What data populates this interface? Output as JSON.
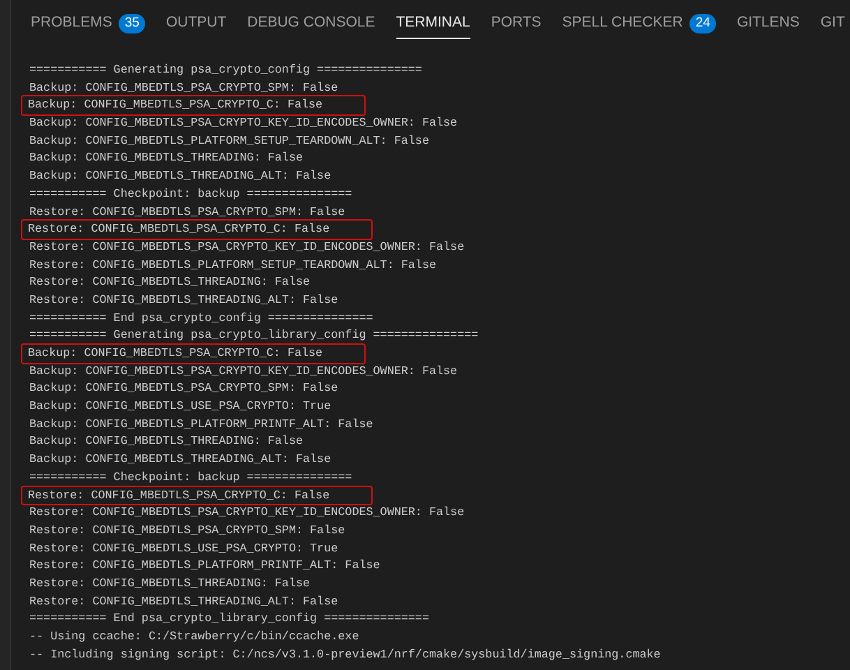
{
  "tabs": [
    {
      "label": "PROBLEMS",
      "badge": "35",
      "selected": false
    },
    {
      "label": "OUTPUT",
      "selected": false
    },
    {
      "label": "DEBUG CONSOLE",
      "selected": false
    },
    {
      "label": "TERMINAL",
      "selected": true
    },
    {
      "label": "PORTS",
      "selected": false
    },
    {
      "label": "SPELL CHECKER",
      "badge": "24",
      "selected": false
    },
    {
      "label": "GITLENS",
      "selected": false
    },
    {
      "label": "GIT",
      "selected": false
    }
  ],
  "terminal": {
    "lines": [
      {
        "text": "=========== Generating psa_crypto_config ===============",
        "highlighted": false
      },
      {
        "text": "Backup: CONFIG_MBEDTLS_PSA_CRYPTO_SPM: False",
        "highlighted": false
      },
      {
        "text": "Backup: CONFIG_MBEDTLS_PSA_CRYPTO_C: False",
        "highlighted": true
      },
      {
        "text": "Backup: CONFIG_MBEDTLS_PSA_CRYPTO_KEY_ID_ENCODES_OWNER: False",
        "highlighted": false
      },
      {
        "text": "Backup: CONFIG_MBEDTLS_PLATFORM_SETUP_TEARDOWN_ALT: False",
        "highlighted": false
      },
      {
        "text": "Backup: CONFIG_MBEDTLS_THREADING: False",
        "highlighted": false
      },
      {
        "text": "Backup: CONFIG_MBEDTLS_THREADING_ALT: False",
        "highlighted": false
      },
      {
        "text": "=========== Checkpoint: backup ===============",
        "highlighted": false
      },
      {
        "text": "Restore: CONFIG_MBEDTLS_PSA_CRYPTO_SPM: False",
        "highlighted": false
      },
      {
        "text": "Restore: CONFIG_MBEDTLS_PSA_CRYPTO_C: False",
        "highlighted": true
      },
      {
        "text": "Restore: CONFIG_MBEDTLS_PSA_CRYPTO_KEY_ID_ENCODES_OWNER: False",
        "highlighted": false
      },
      {
        "text": "Restore: CONFIG_MBEDTLS_PLATFORM_SETUP_TEARDOWN_ALT: False",
        "highlighted": false
      },
      {
        "text": "Restore: CONFIG_MBEDTLS_THREADING: False",
        "highlighted": false
      },
      {
        "text": "Restore: CONFIG_MBEDTLS_THREADING_ALT: False",
        "highlighted": false
      },
      {
        "text": "=========== End psa_crypto_config ===============",
        "highlighted": false
      },
      {
        "text": "=========== Generating psa_crypto_library_config ===============",
        "highlighted": false
      },
      {
        "text": "Backup: CONFIG_MBEDTLS_PSA_CRYPTO_C: False",
        "highlighted": true
      },
      {
        "text": "Backup: CONFIG_MBEDTLS_PSA_CRYPTO_KEY_ID_ENCODES_OWNER: False",
        "highlighted": false
      },
      {
        "text": "Backup: CONFIG_MBEDTLS_PSA_CRYPTO_SPM: False",
        "highlighted": false
      },
      {
        "text": "Backup: CONFIG_MBEDTLS_USE_PSA_CRYPTO: True",
        "highlighted": false
      },
      {
        "text": "Backup: CONFIG_MBEDTLS_PLATFORM_PRINTF_ALT: False",
        "highlighted": false
      },
      {
        "text": "Backup: CONFIG_MBEDTLS_THREADING: False",
        "highlighted": false
      },
      {
        "text": "Backup: CONFIG_MBEDTLS_THREADING_ALT: False",
        "highlighted": false
      },
      {
        "text": "=========== Checkpoint: backup ===============",
        "highlighted": false
      },
      {
        "text": "Restore: CONFIG_MBEDTLS_PSA_CRYPTO_C: False",
        "highlighted": true
      },
      {
        "text": "Restore: CONFIG_MBEDTLS_PSA_CRYPTO_KEY_ID_ENCODES_OWNER: False",
        "highlighted": false
      },
      {
        "text": "Restore: CONFIG_MBEDTLS_PSA_CRYPTO_SPM: False",
        "highlighted": false
      },
      {
        "text": "Restore: CONFIG_MBEDTLS_USE_PSA_CRYPTO: True",
        "highlighted": false
      },
      {
        "text": "Restore: CONFIG_MBEDTLS_PLATFORM_PRINTF_ALT: False",
        "highlighted": false
      },
      {
        "text": "Restore: CONFIG_MBEDTLS_THREADING: False",
        "highlighted": false
      },
      {
        "text": "Restore: CONFIG_MBEDTLS_THREADING_ALT: False",
        "highlighted": false
      },
      {
        "text": "=========== End psa_crypto_library_config ===============",
        "highlighted": false
      },
      {
        "text": "-- Using ccache: C:/Strawberry/c/bin/ccache.exe",
        "highlighted": false
      },
      {
        "text": "-- Including signing script: C:/ncs/v3.1.0-preview1/nrf/cmake/sysbuild/image_signing.cmake",
        "highlighted": false
      }
    ]
  }
}
